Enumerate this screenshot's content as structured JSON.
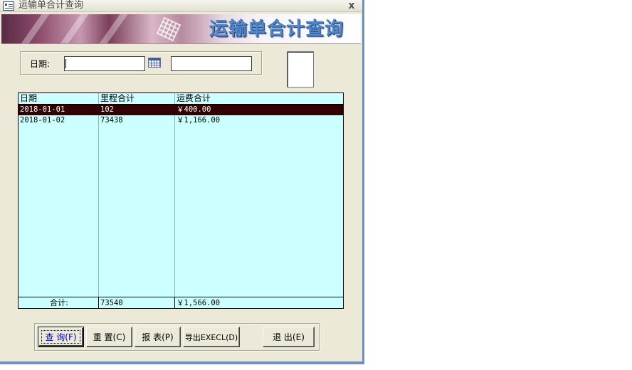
{
  "window": {
    "title": "运输单合计查询",
    "close_glyph": "x"
  },
  "banner": {
    "title": "运输单合计查询"
  },
  "filter": {
    "date_label": "日期:",
    "start_date": "",
    "end_date": ""
  },
  "grid": {
    "columns": [
      "日期",
      "里程合计",
      "运费合计"
    ],
    "rows": [
      {
        "date": "2018-01-01",
        "mileage": "102",
        "freight": "￥400.00"
      },
      {
        "date": "2018-01-02",
        "mileage": "73438",
        "freight": "￥1,166.00"
      }
    ],
    "selected_row": 0,
    "total": {
      "label": "合计:",
      "mileage": "73540",
      "freight": "￥1,566.00"
    },
    "colors": {
      "background": "#ccffff",
      "selected": "#330000"
    }
  },
  "buttons": {
    "query": "查 询(F)",
    "reset": "重 置(C)",
    "report": "报 表(P)",
    "export": "导出EXECL(D)",
    "exit": "退 出(E)"
  },
  "icons": {
    "app": "form-icon",
    "date_picker": "calendar-icon"
  }
}
